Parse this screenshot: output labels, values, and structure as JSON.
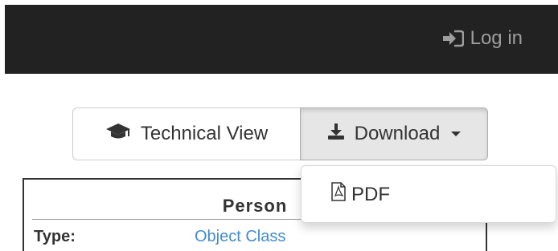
{
  "navbar": {
    "login_label": "Log in",
    "login_icon": "sign-in-icon",
    "background": "#222222",
    "link_color": "#9d9d9d"
  },
  "toolbar": {
    "technical_view_label": "Technical View",
    "technical_view_icon": "graduation-cap-icon",
    "download_label": "Download",
    "download_icon": "download-icon"
  },
  "dropdown": {
    "items": [
      {
        "label": "PDF",
        "icon": "file-pdf-icon"
      }
    ]
  },
  "panel": {
    "title": "Person",
    "rows": [
      {
        "label": "Type:",
        "value": "Object Class"
      }
    ],
    "link_color": "#428bca"
  }
}
